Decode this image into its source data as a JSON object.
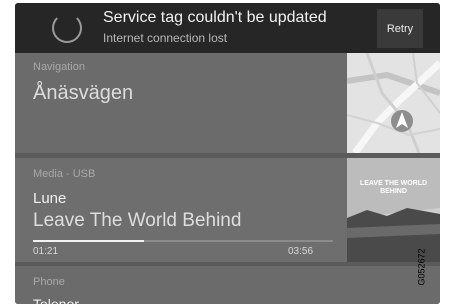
{
  "notification": {
    "title": "Service tag couldn't be updated",
    "subtitle": "Internet connection lost",
    "retry_label": "Retry",
    "icon": "loading-spinner-icon"
  },
  "navigation": {
    "label": "Navigation",
    "street": "Ånäsvägen",
    "map_icon": "map-thumbnail"
  },
  "media": {
    "label": "Media - USB",
    "artist": "Lune",
    "track": "Leave The World Behind",
    "elapsed": "01:21",
    "total": "03:56",
    "progress_fraction": 0.37,
    "album_text": "LEAVE THE WORLD BEHIND"
  },
  "phone": {
    "label": "Phone",
    "operator": "Telenor"
  },
  "figure_code": "G052672"
}
